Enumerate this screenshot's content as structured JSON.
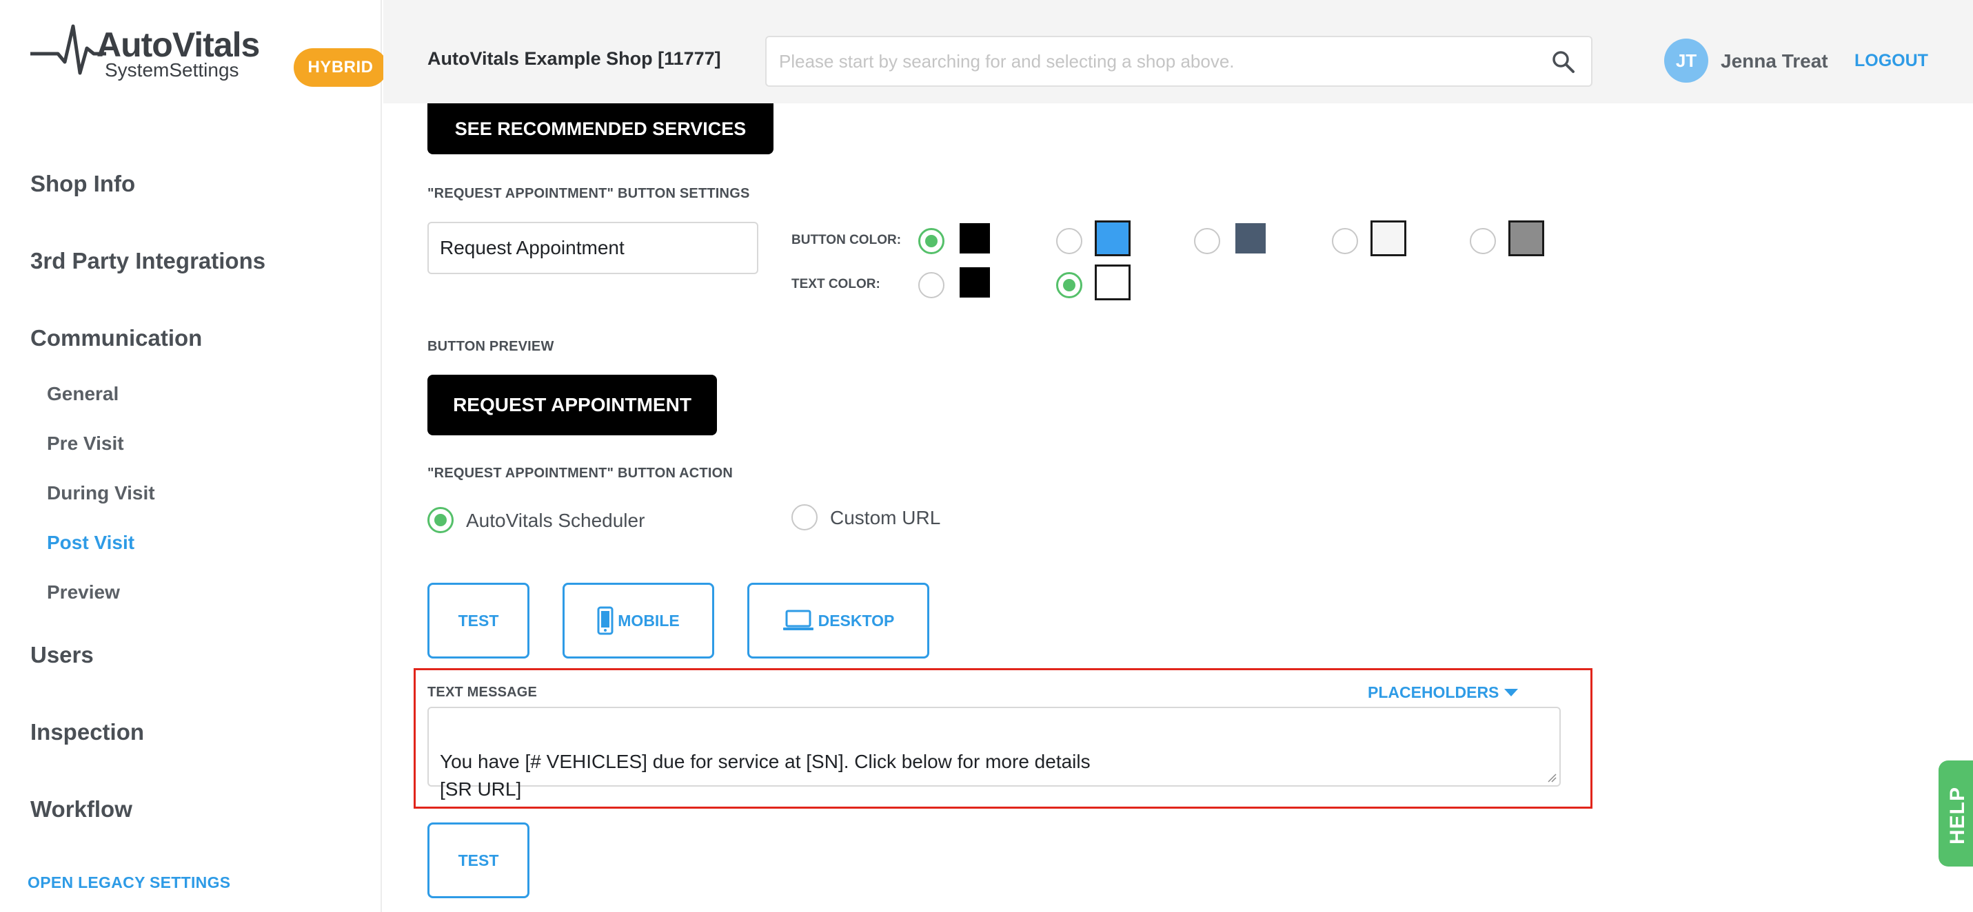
{
  "brand": {
    "name": "AutoVitals",
    "subtitle": "SystemSettings",
    "badge": "HYBRID",
    "badge_color": "#f5a623"
  },
  "sidebar": {
    "sections": [
      {
        "label": "Shop Info"
      },
      {
        "label": "3rd Party Integrations"
      },
      {
        "label": "Communication"
      },
      {
        "label": "Users"
      },
      {
        "label": "Inspection"
      },
      {
        "label": "Workflow"
      }
    ],
    "communication_items": [
      {
        "label": "General"
      },
      {
        "label": "Pre Visit"
      },
      {
        "label": "During Visit"
      },
      {
        "label": "Post Visit",
        "active": true
      },
      {
        "label": "Preview"
      }
    ],
    "legacy_link": "OPEN LEGACY SETTINGS"
  },
  "header": {
    "shop_name": "AutoVitals Example Shop [11777]",
    "search_placeholder": "Please start by searching for and selecting a shop above.",
    "search_icon": "search-icon",
    "user_initials": "JT",
    "user_name": "Jenna Treat",
    "logout_label": "LOGOUT"
  },
  "main": {
    "recommended_button": "SEE RECOMMENDED SERVICES",
    "request_settings_label": "\"REQUEST APPOINTMENT\" BUTTON SETTINGS",
    "request_button_text_value": "Request Appointment",
    "button_color_label": "BUTTON COLOR:",
    "text_color_label": "TEXT COLOR:",
    "button_colors": [
      "#000000",
      "#3a9ff0",
      "#4a5b70",
      "#f5f5f5",
      "#8c8c8c"
    ],
    "button_color_selected": 0,
    "text_colors": [
      "#000000",
      "#ffffff"
    ],
    "text_color_selected": 1,
    "button_preview_label": "BUTTON PREVIEW",
    "preview_button": "REQUEST APPOINTMENT",
    "action_label": "\"REQUEST APPOINTMENT\" BUTTON ACTION",
    "action_options": [
      {
        "label": "AutoVitals Scheduler",
        "selected": true
      },
      {
        "label": "Custom URL",
        "selected": false
      }
    ],
    "test_label": "TEST",
    "mobile_label": "MOBILE",
    "desktop_label": "DESKTOP",
    "text_message_label": "TEXT MESSAGE",
    "placeholders_label": "PLACEHOLDERS",
    "text_message_value": "You have [# VEHICLES] due for service at [SN]. Click below for more details\n[SR URL]",
    "test2_label": "TEST"
  },
  "help_label": "HELP",
  "colors": {
    "accent": "#2e9be6",
    "success": "#55c06a",
    "highlight": "#e1251b"
  }
}
